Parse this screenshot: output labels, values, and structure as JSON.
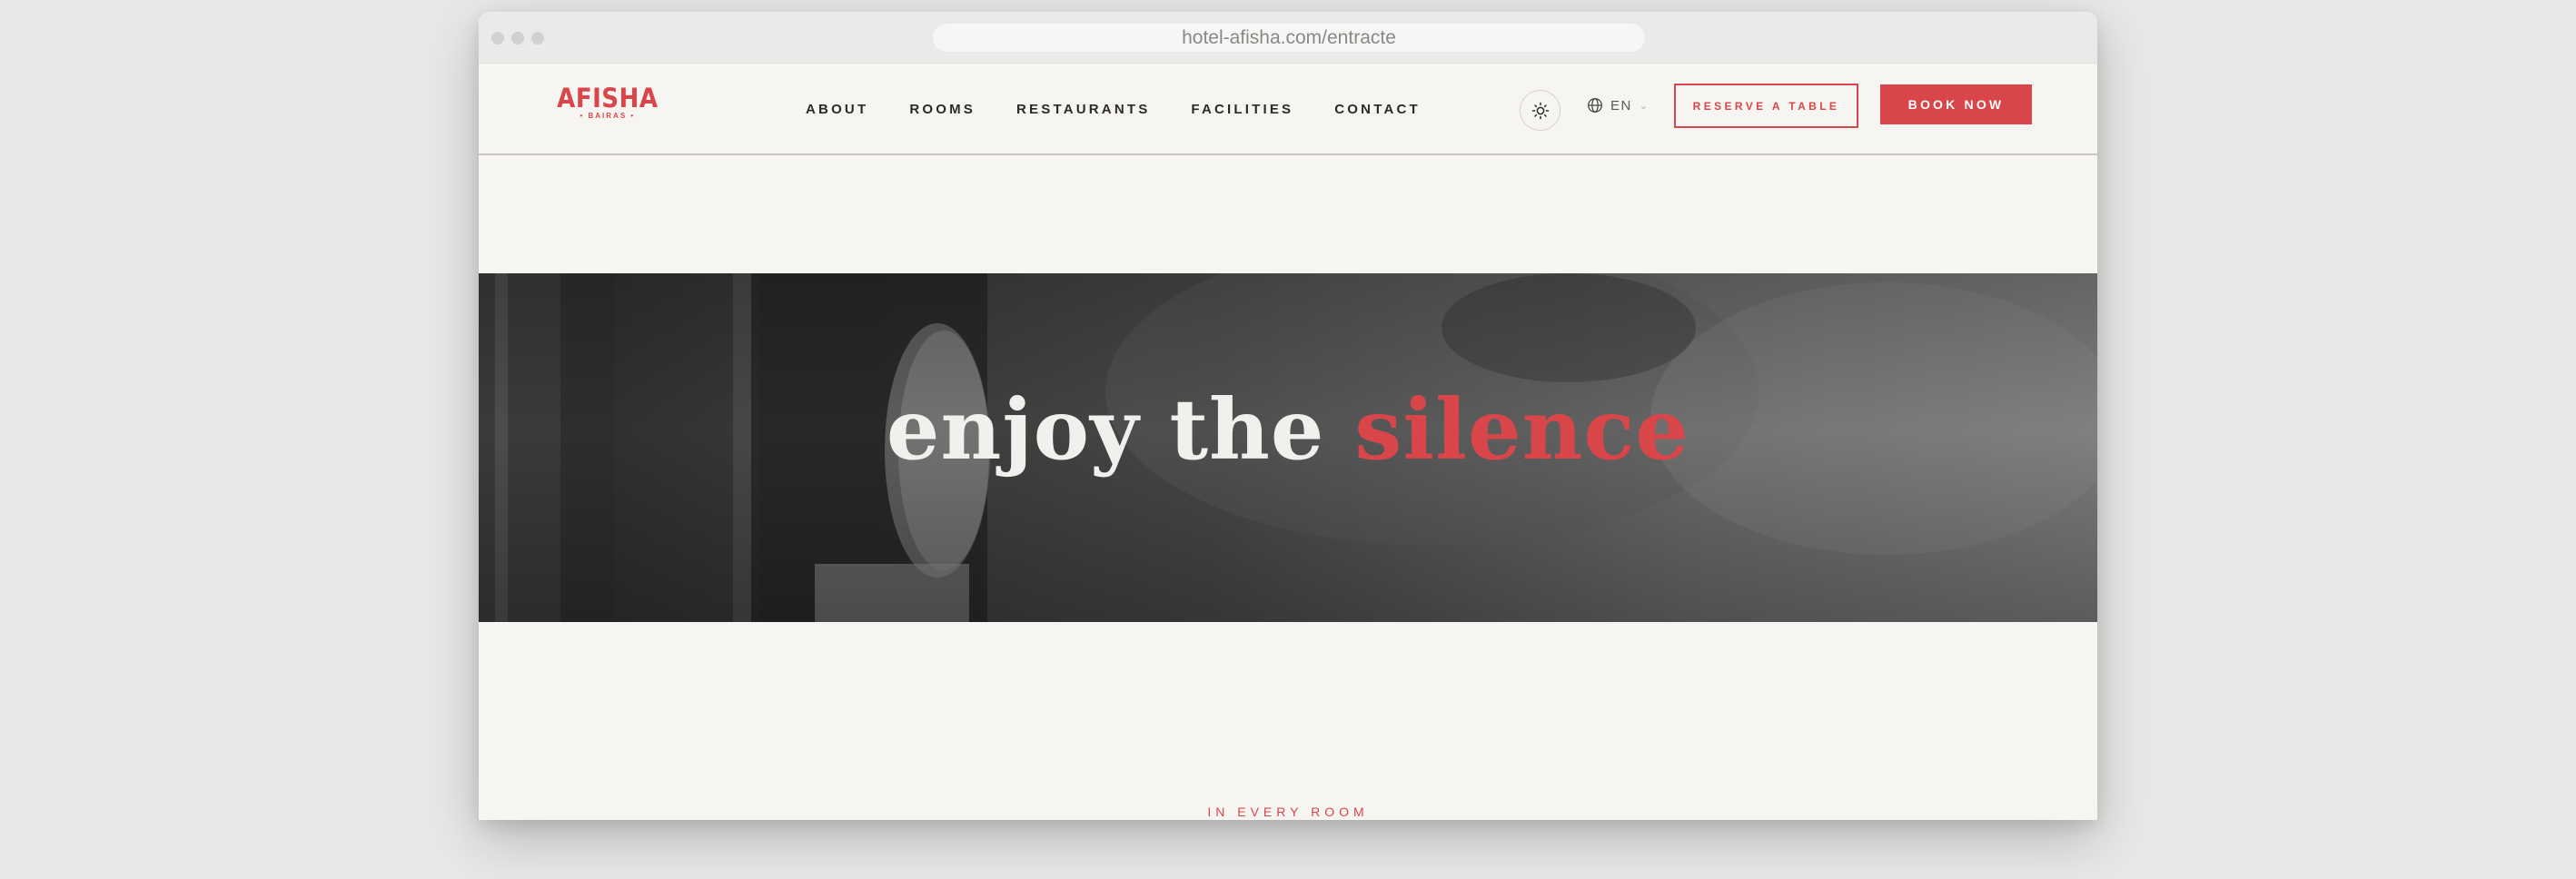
{
  "browser": {
    "url": "hotel-afisha.com/entracte"
  },
  "brand": {
    "name": "AFISHA",
    "subtitle": "• BAIRAS •",
    "accent_color": "#d9464a"
  },
  "nav": {
    "links": [
      {
        "label": "ABOUT"
      },
      {
        "label": "ROOMS"
      },
      {
        "label": "RESTAURANTS"
      },
      {
        "label": "FACILITIES"
      },
      {
        "label": "CONTACT"
      }
    ],
    "theme_icon": "sun-icon",
    "language": {
      "icon": "globe-icon",
      "label": "EN",
      "chevron": "chevron-down-icon"
    },
    "reserve_label": "RESERVE A TABLE",
    "book_label": "BOOK NOW"
  },
  "hero": {
    "title_main": "enjoy the",
    "title_accent": "silence"
  },
  "section": {
    "label": "IN EVERY ROOM"
  }
}
